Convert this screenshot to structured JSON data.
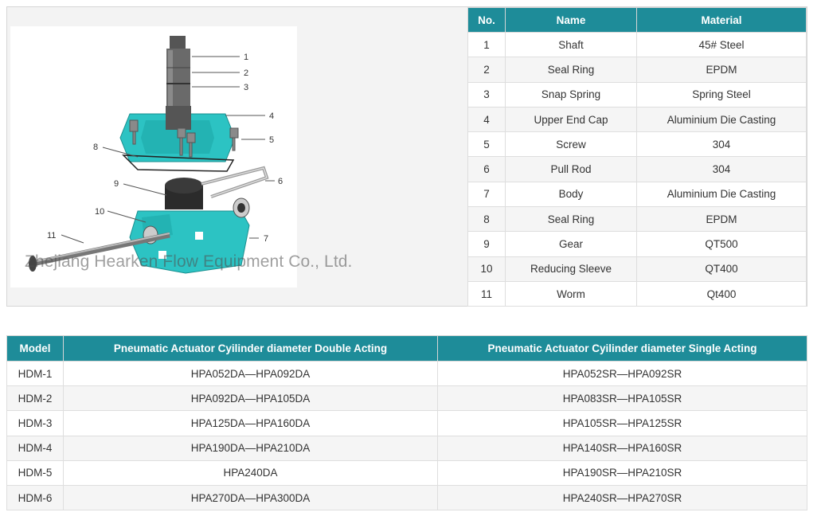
{
  "diagram": {
    "callouts": [
      "1",
      "2",
      "3",
      "4",
      "5",
      "6",
      "7",
      "8",
      "9",
      "10",
      "11"
    ],
    "watermark": "Zhejiang Hearken Flow Equipment Co., Ltd."
  },
  "parts_table": {
    "headers": [
      "No.",
      "Name",
      "Material"
    ],
    "rows": [
      [
        "1",
        "Shaft",
        "45# Steel"
      ],
      [
        "2",
        "Seal Ring",
        "EPDM"
      ],
      [
        "3",
        "Snap Spring",
        "Spring Steel"
      ],
      [
        "4",
        "Upper End Cap",
        "Aluminium Die Casting"
      ],
      [
        "5",
        "Screw",
        "304"
      ],
      [
        "6",
        "Pull Rod",
        "304"
      ],
      [
        "7",
        "Body",
        "Aluminium Die Casting"
      ],
      [
        "8",
        "Seal Ring",
        "EPDM"
      ],
      [
        "9",
        "Gear",
        "QT500"
      ],
      [
        "10",
        "Reducing Sleeve",
        "QT400"
      ],
      [
        "11",
        "Worm",
        "Qt400"
      ]
    ]
  },
  "model_table": {
    "headers": [
      "Model",
      "Pneumatic Actuator Cyilinder diameter Double Acting",
      "Pneumatic Actuator Cyilinder diameter Single Acting"
    ],
    "rows": [
      [
        "HDM-1",
        "HPA052DA—HPA092DA",
        "HPA052SR—HPA092SR"
      ],
      [
        "HDM-2",
        "HPA092DA—HPA105DA",
        "HPA083SR—HPA105SR"
      ],
      [
        "HDM-3",
        "HPA125DA—HPA160DA",
        "HPA105SR—HPA125SR"
      ],
      [
        "HDM-4",
        "HPA190DA—HPA210DA",
        "HPA140SR—HPA160SR"
      ],
      [
        "HDM-5",
        "HPA240DA",
        "HPA190SR—HPA210SR"
      ],
      [
        "HDM-6",
        "HPA270DA—HPA300DA",
        "HPA240SR—HPA270SR"
      ]
    ]
  },
  "colors": {
    "header_bg": "#1e8c99",
    "part_teal": "#2cc3c3",
    "border": "#d6d6d6"
  }
}
